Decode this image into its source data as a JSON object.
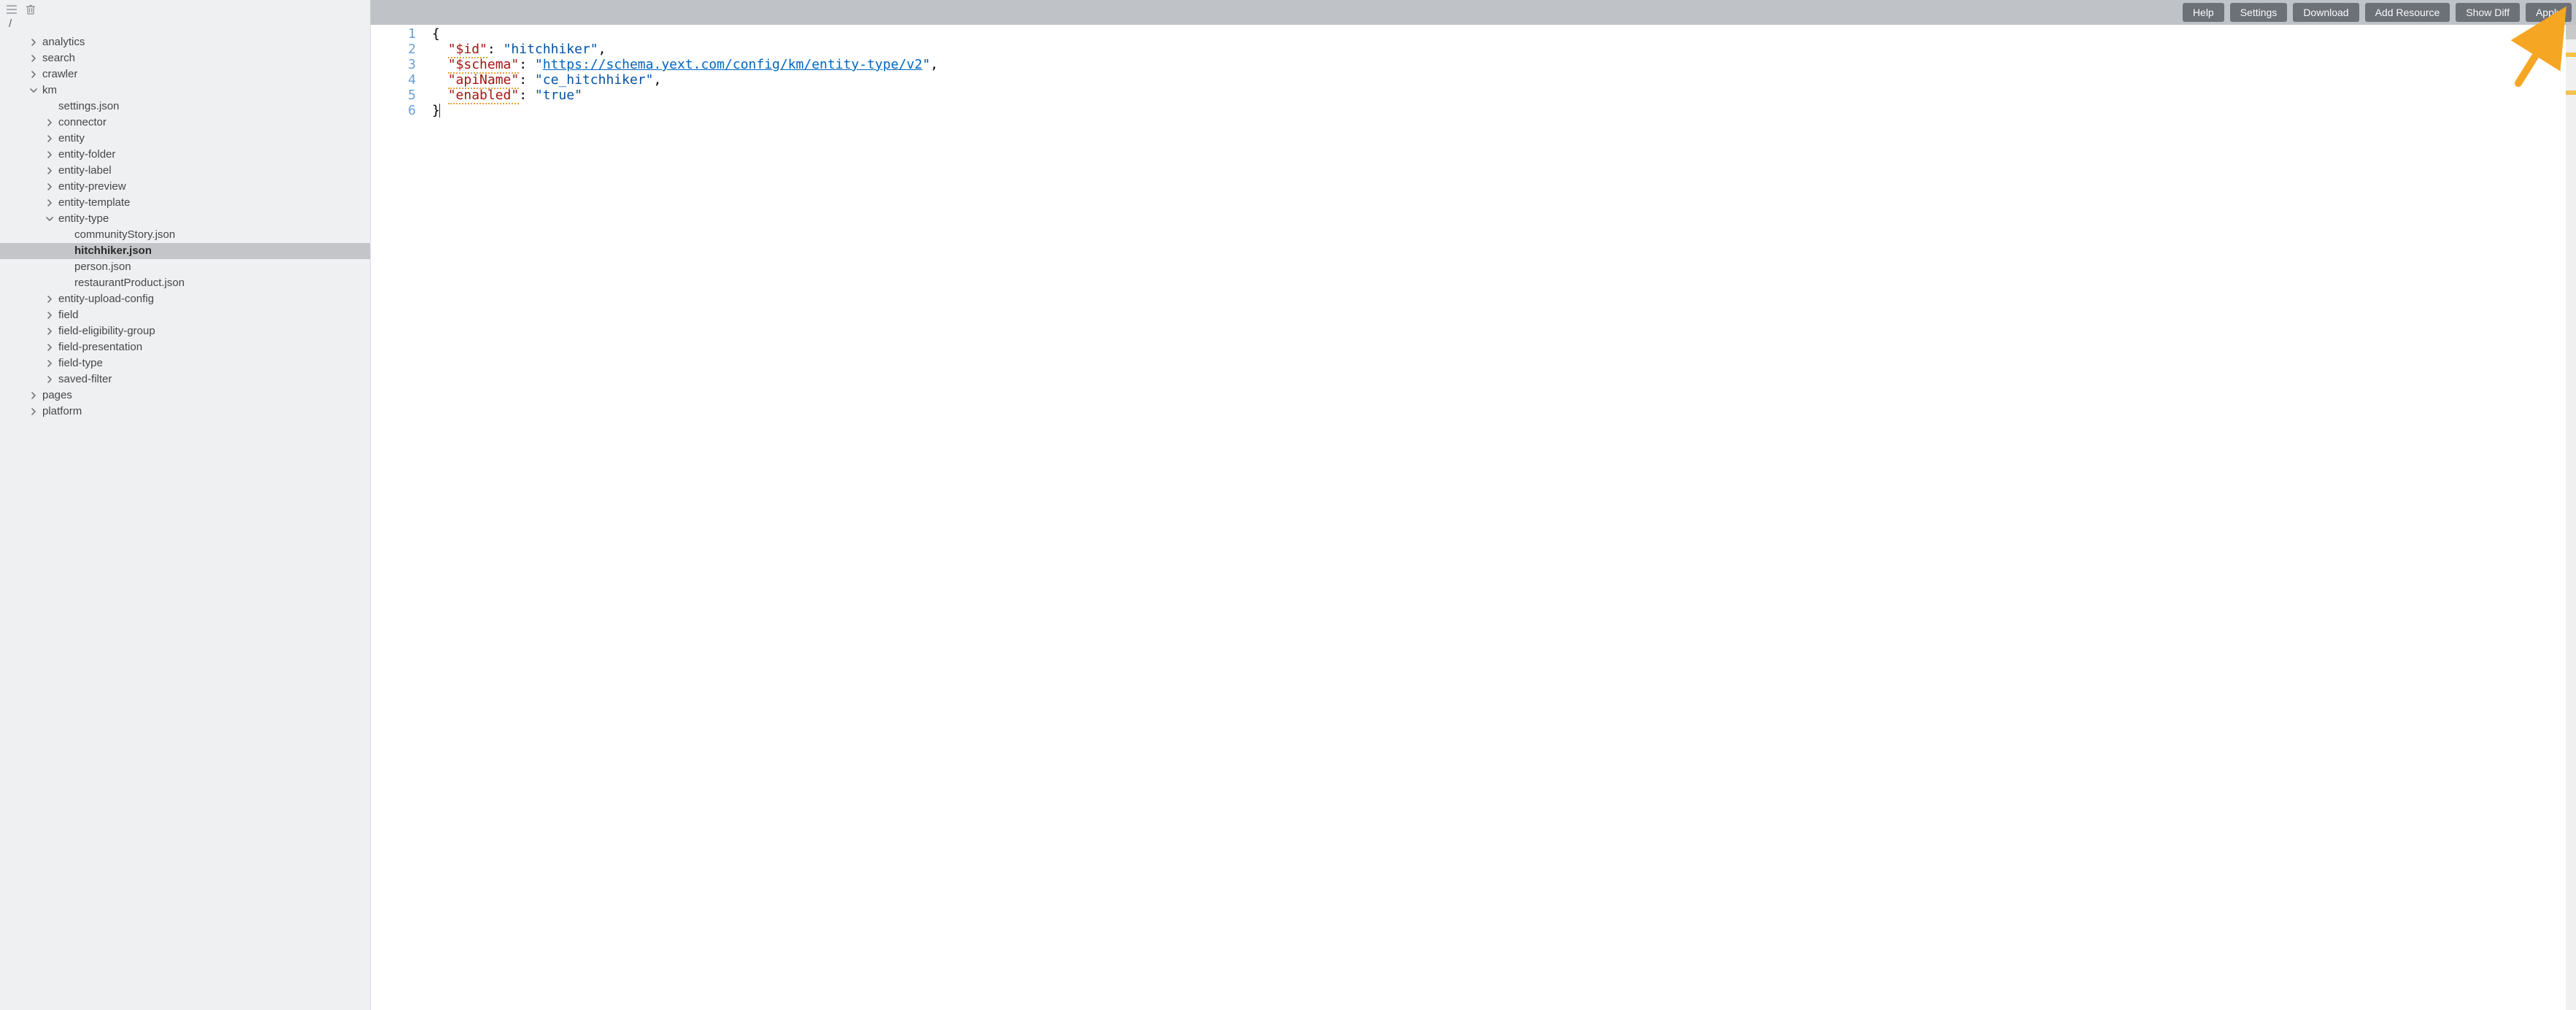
{
  "breadcrumb": "/",
  "sidebar": {
    "root": [
      {
        "label": "analytics",
        "kind": "folder",
        "expanded": false
      },
      {
        "label": "search",
        "kind": "folder",
        "expanded": false
      },
      {
        "label": "crawler",
        "kind": "folder",
        "expanded": false
      },
      {
        "label": "km",
        "kind": "folder",
        "expanded": true,
        "children": [
          {
            "label": "settings.json",
            "kind": "file"
          },
          {
            "label": "connector",
            "kind": "folder",
            "expanded": false
          },
          {
            "label": "entity",
            "kind": "folder",
            "expanded": false
          },
          {
            "label": "entity-folder",
            "kind": "folder",
            "expanded": false
          },
          {
            "label": "entity-label",
            "kind": "folder",
            "expanded": false
          },
          {
            "label": "entity-preview",
            "kind": "folder",
            "expanded": false
          },
          {
            "label": "entity-template",
            "kind": "folder",
            "expanded": false
          },
          {
            "label": "entity-type",
            "kind": "folder",
            "expanded": true,
            "children": [
              {
                "label": "communityStory.json",
                "kind": "file"
              },
              {
                "label": "hitchhiker.json",
                "kind": "file",
                "selected": true
              },
              {
                "label": "person.json",
                "kind": "file"
              },
              {
                "label": "restaurantProduct.json",
                "kind": "file"
              }
            ]
          },
          {
            "label": "entity-upload-config",
            "kind": "folder",
            "expanded": false
          },
          {
            "label": "field",
            "kind": "folder",
            "expanded": false
          },
          {
            "label": "field-eligibility-group",
            "kind": "folder",
            "expanded": false
          },
          {
            "label": "field-presentation",
            "kind": "folder",
            "expanded": false
          },
          {
            "label": "field-type",
            "kind": "folder",
            "expanded": false
          },
          {
            "label": "saved-filter",
            "kind": "folder",
            "expanded": false
          }
        ]
      },
      {
        "label": "pages",
        "kind": "folder",
        "expanded": false
      },
      {
        "label": "platform",
        "kind": "folder",
        "expanded": false
      }
    ]
  },
  "toolbar": {
    "buttons": [
      {
        "id": "help",
        "label": "Help"
      },
      {
        "id": "settings",
        "label": "Settings"
      },
      {
        "id": "download",
        "label": "Download"
      },
      {
        "id": "add-resource",
        "label": "Add Resource"
      },
      {
        "id": "show-diff",
        "label": "Show Diff"
      },
      {
        "id": "apply",
        "label": "Apply"
      }
    ]
  },
  "editor": {
    "lineNumbers": [
      "1",
      "2",
      "3",
      "4",
      "5",
      "6"
    ],
    "lines": [
      {
        "tokens": [
          {
            "t": "{",
            "cls": "t-pun"
          }
        ]
      },
      {
        "tokens": [
          {
            "t": "  ",
            "cls": ""
          },
          {
            "t": "\"$id\"",
            "cls": "t-prop lint"
          },
          {
            "t": ": ",
            "cls": "t-pun"
          },
          {
            "t": "\"hitchhiker\"",
            "cls": "t-str"
          },
          {
            "t": ",",
            "cls": "t-pun"
          }
        ]
      },
      {
        "tokens": [
          {
            "t": "  ",
            "cls": ""
          },
          {
            "t": "\"$schema\"",
            "cls": "t-prop lint"
          },
          {
            "t": ": ",
            "cls": "t-pun"
          },
          {
            "t": "\"",
            "cls": "t-str"
          },
          {
            "t": "https://schema.yext.com/config/km/entity-type/v2",
            "cls": "t-link"
          },
          {
            "t": "\"",
            "cls": "t-str"
          },
          {
            "t": ",",
            "cls": "t-pun"
          }
        ]
      },
      {
        "tokens": [
          {
            "t": "  ",
            "cls": ""
          },
          {
            "t": "\"apiName\"",
            "cls": "t-prop lint"
          },
          {
            "t": ": ",
            "cls": "t-pun"
          },
          {
            "t": "\"ce_hitchhiker\"",
            "cls": "t-str"
          },
          {
            "t": ",",
            "cls": "t-pun"
          }
        ]
      },
      {
        "tokens": [
          {
            "t": "  ",
            "cls": ""
          },
          {
            "t": "\"enabled\"",
            "cls": "t-prop lint"
          },
          {
            "t": ": ",
            "cls": "t-pun"
          },
          {
            "t": "\"true\"",
            "cls": "t-str"
          }
        ]
      },
      {
        "tokens": [
          {
            "t": "}",
            "cls": "t-pun"
          }
        ],
        "current": true
      }
    ]
  }
}
